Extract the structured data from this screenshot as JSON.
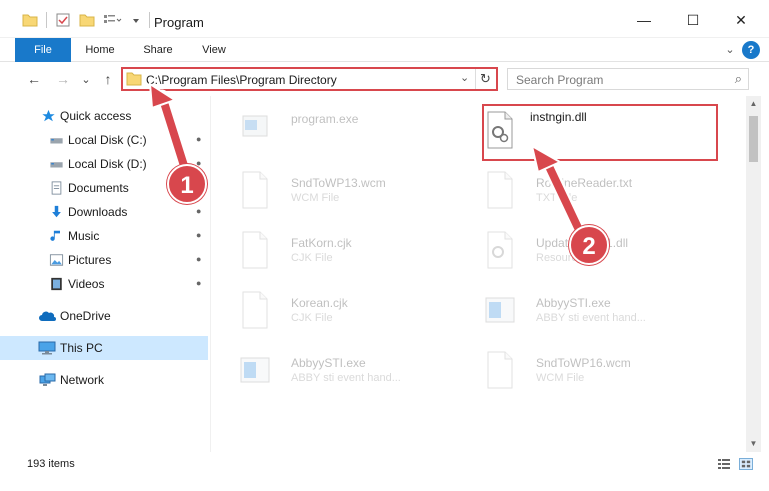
{
  "window": {
    "title": "Program",
    "minimize_glyph": "—",
    "maximize_glyph": "☐",
    "close_glyph": "✕"
  },
  "ribbon": {
    "tabs": [
      "File",
      "Home",
      "Share",
      "View"
    ],
    "expand_glyph": "⌄",
    "help_glyph": "?"
  },
  "nav": {
    "back_glyph": "←",
    "forward_glyph": "→",
    "recent_glyph": "⌄",
    "up_glyph": "↑",
    "address": "C:\\Program Files\\Program Directory",
    "address_dropdown_glyph": "⌄",
    "refresh_glyph": "↻",
    "search_placeholder": "Search Program",
    "search_glyph": "⌕"
  },
  "sidebar": {
    "items": [
      {
        "label": "Quick access",
        "icon": "star-icon",
        "pinned": false
      },
      {
        "label": "Local Disk (C:)",
        "icon": "drive-icon",
        "pinned": true
      },
      {
        "label": "Local Disk (D:)",
        "icon": "drive-icon",
        "pinned": true
      },
      {
        "label": "Documents",
        "icon": "documents-icon",
        "pinned": true
      },
      {
        "label": "Downloads",
        "icon": "downloads-icon",
        "pinned": true
      },
      {
        "label": "Music",
        "icon": "music-icon",
        "pinned": true
      },
      {
        "label": "Pictures",
        "icon": "pictures-icon",
        "pinned": true
      },
      {
        "label": "Videos",
        "icon": "videos-icon",
        "pinned": true
      },
      {
        "label": "OneDrive",
        "icon": "onedrive-icon",
        "pinned": false
      },
      {
        "label": "This PC",
        "icon": "this-pc-icon",
        "pinned": false,
        "selected": true
      },
      {
        "label": "Network",
        "icon": "network-icon",
        "pinned": false
      }
    ],
    "pin_glyph": "📌"
  },
  "files": [
    {
      "name": "program.exe",
      "type": "",
      "icon": "exe-icon"
    },
    {
      "name": "instngin.dll",
      "type": "",
      "icon": "dll-icon",
      "highlighted": true
    },
    {
      "name": "SndToWP13.wcm",
      "type": "WCM File",
      "icon": "blank-file-icon"
    },
    {
      "name": "RoutineReader.txt",
      "type": "TXT File",
      "icon": "blank-file-icon"
    },
    {
      "name": "FatKorn.cjk",
      "type": "CJK File",
      "icon": "blank-file-icon"
    },
    {
      "name": "UpdateCast21.dll",
      "type": "Resources",
      "icon": "dll-icon"
    },
    {
      "name": "Korean.cjk",
      "type": "CJK File",
      "icon": "blank-file-icon"
    },
    {
      "name": "AbbyySTI.exe",
      "type": "ABBY sti event hand...",
      "icon": "exe-app-icon"
    },
    {
      "name": "AbbyySTI.exe",
      "type": "ABBY sti event hand...",
      "icon": "exe-app-icon"
    },
    {
      "name": "SndToWP16.wcm",
      "type": "WCM File",
      "icon": "blank-file-icon"
    }
  ],
  "status": {
    "item_count": "193 items"
  },
  "callouts": [
    "1",
    "2"
  ],
  "colors": {
    "accent": "#1979ca",
    "highlight": "#d8474d",
    "selected": "#cde8ff"
  }
}
